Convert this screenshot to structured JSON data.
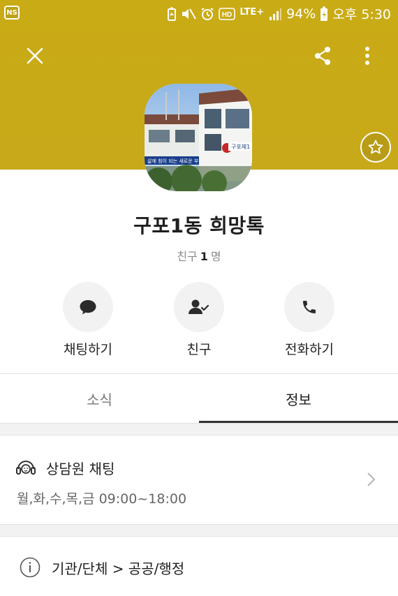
{
  "status_bar": {
    "badge": "NS",
    "network": "LTE+",
    "battery": "94%",
    "time": "오후 5:30"
  },
  "header": {
    "color": "#c9ab15",
    "icons": [
      "close-icon",
      "share-icon",
      "more-vertical-icon",
      "star-icon"
    ]
  },
  "profile": {
    "name": "구포1동 희망톡",
    "friends_prefix": "친구",
    "friends_count": "1",
    "friends_suffix": "명"
  },
  "actions": [
    {
      "label": "채팅하기",
      "icon": "chat-bubble-icon"
    },
    {
      "label": "친구",
      "icon": "friend-check-icon"
    },
    {
      "label": "전화하기",
      "icon": "phone-icon"
    }
  ],
  "tabs": [
    {
      "label": "소식",
      "active": false
    },
    {
      "label": "정보",
      "active": true
    }
  ],
  "counsel": {
    "title": "상담원 채팅",
    "hours": "월,화,수,목,금 09:00~18:00",
    "icon": "headset-icon"
  },
  "category": {
    "text": "기관/단체 > 공공/행정",
    "icon": "info-icon"
  }
}
